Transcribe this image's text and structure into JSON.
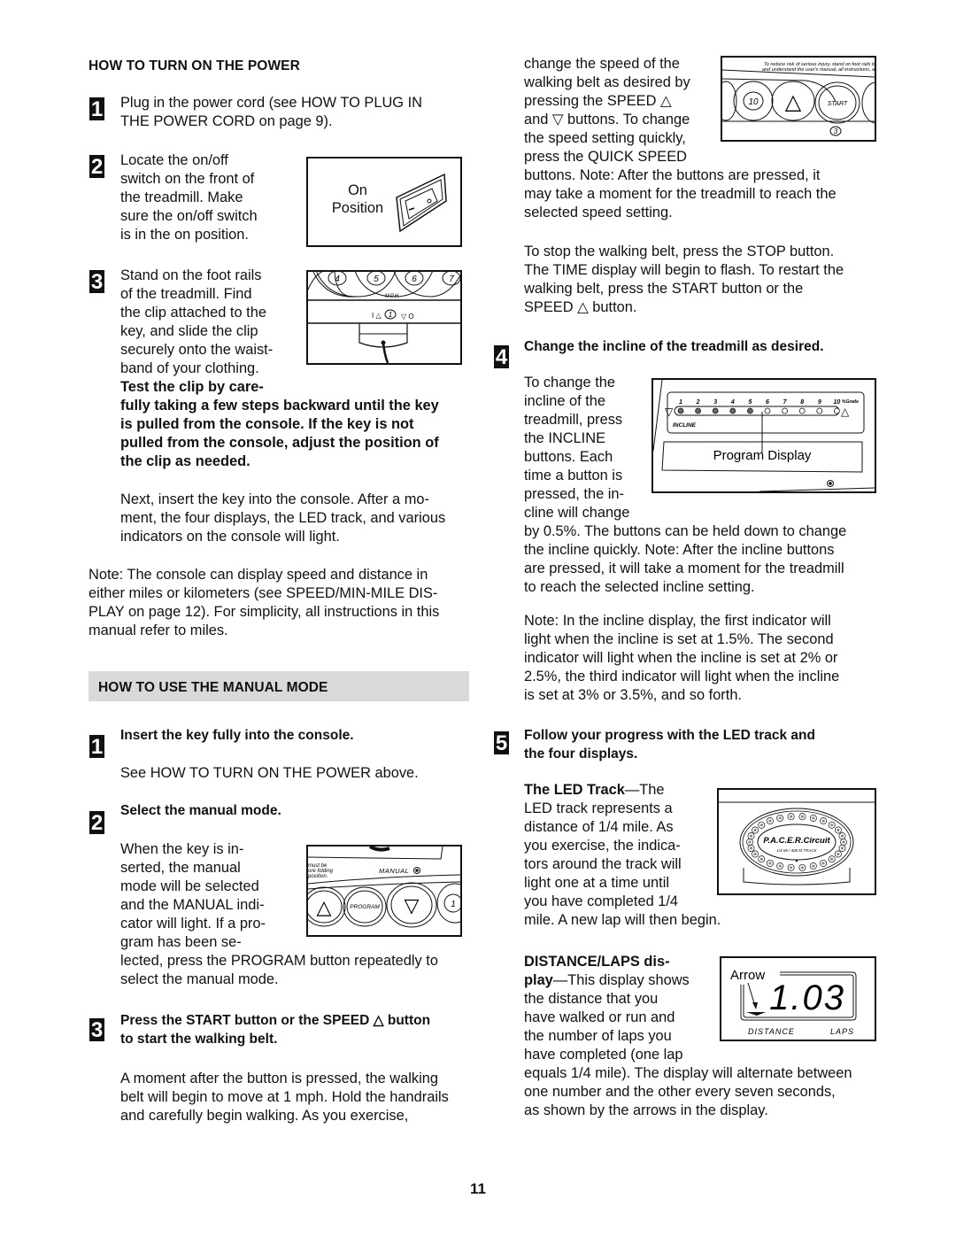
{
  "left": {
    "power_heading": "HOW TO TURN ON THE POWER",
    "power_steps": [
      {
        "num": "1",
        "lines": [
          "Plug in the power cord (see HOW TO PLUG IN",
          "THE POWER CORD on page 9)."
        ]
      },
      {
        "num": "2",
        "lines": [
          "Locate the on/off",
          "switch on the front of",
          "the treadmill. Make",
          "sure the on/off switch",
          "is in the on position."
        ]
      },
      {
        "num": "3",
        "lines": [
          "Stand on the foot rails",
          "of the treadmill. Find",
          "the clip attached to the",
          "key, and slide the clip",
          "securely onto the waist-",
          "band of your clothing."
        ],
        "bold_lines": [
          "Test the clip by care-",
          "fully taking a few steps backward until the key",
          "is pulled from the console. If the key is not",
          "pulled from the console, adjust the position of",
          "the clip as needed."
        ]
      }
    ],
    "switch_figure": {
      "label_line1": "On",
      "label_line2": "Position"
    },
    "key_figure": {
      "speeds": [
        "4",
        "5",
        "6",
        "7"
      ],
      "unit": "MPH",
      "key_label": "1"
    },
    "next_paragraph": [
      "Next, insert the key into the console. After a mo-",
      "ment, the four displays, the LED track, and various",
      "indicators on the console will light."
    ],
    "note_paragraph": [
      "Note: The console can display speed and distance in",
      "either miles or kilometers (see SPEED/MIN-MILE DIS-",
      "PLAY on page 12). For simplicity, all instructions in this",
      "manual refer to miles."
    ],
    "manual_heading": "HOW TO USE THE MANUAL MODE",
    "manual_steps": [
      {
        "num": "1",
        "title": "Insert the key fully into the console.",
        "body": "See HOW TO TURN ON THE POWER above."
      },
      {
        "num": "2",
        "title": "Select the manual mode.",
        "body_lines": [
          "When the key is in-",
          "serted, the manual",
          "mode will be selected",
          "and the MANUAL indi-",
          "cator will light. If a pro-",
          "gram has been se-",
          "lected, press the PROGRAM button repeatedly to",
          "select the manual mode."
        ]
      },
      {
        "num": "3",
        "title_lines": [
          "Press the START button or the SPEED △ button",
          "to start the walking belt."
        ],
        "body_lines": [
          "A moment after the button is pressed, the walking",
          "belt will begin to move at 1 mph. Hold the handrails",
          "and carefully begin walking. As you exercise,"
        ]
      }
    ],
    "manual_figure": {
      "warning_lines": [
        "must be",
        "ore folding",
        "position."
      ],
      "indicator_label": "MANUAL",
      "buttons": [
        "△",
        "PROGRAM",
        "▽",
        "1"
      ]
    }
  },
  "right": {
    "speed_paragraph": [
      "change the speed of the",
      "walking belt as desired by",
      "pressing the SPEED △",
      "and ▽ buttons. To change",
      "the speed setting quickly,",
      "press the QUICK SPEED",
      "buttons. Note: After the buttons are pressed, it",
      "may take a moment for the treadmill to reach the",
      "selected speed setting."
    ],
    "speed_figure": {
      "warning_lines": [
        "To reduce risk of serious injury, stand on foot rails b",
        "and understand the user's manual, all instructions, a"
      ],
      "buttons": [
        "10",
        "△",
        "START"
      ],
      "sub_label": "3"
    },
    "stop_paragraph": [
      "To stop the walking belt, press the STOP button.",
      "The TIME display will begin to flash. To restart the",
      "walking belt, press the START button or the",
      "SPEED △ button."
    ],
    "step4": {
      "num": "4",
      "title": "Change the incline of the treadmill as desired.",
      "body_lines": [
        "To change the",
        "incline of the",
        "treadmill, press",
        "the INCLINE",
        "buttons. Each",
        "time a button is",
        "pressed, the in-",
        "cline will change",
        "by 0.5%. The buttons can be held down to change",
        "the incline quickly. Note: After the incline buttons",
        "are pressed, it will take a moment for the treadmill",
        "to reach the selected incline setting."
      ],
      "note_lines": [
        "Note: In the incline display, the first indicator will",
        "light when the incline is set at 1.5%. The second",
        "indicator will light when the incline is set at 2% or",
        "2.5%, the third indicator will light when the incline",
        "is set at 3% or 3.5%, and so forth."
      ]
    },
    "incline_figure": {
      "ticks": [
        "1",
        "2",
        "3",
        "4",
        "5",
        "6",
        "7",
        "8",
        "9",
        "10"
      ],
      "unit": "%Grade",
      "label": "INCLINE",
      "callout": "Program Display",
      "lit_count": 5
    },
    "step5": {
      "num": "5",
      "title_lines": [
        "Follow your progress with the LED track and",
        "the four displays."
      ],
      "led_title": "The LED Track",
      "led_lines": [
        "—The",
        "LED track represents a",
        "distance of 1/4 mile. As",
        "you exercise, the indica-",
        "tors around the track will",
        "light one at a time until",
        "you have completed 1/4",
        "mile. A new lap will then begin."
      ],
      "dist_title_1": "DISTANCE/LAPS dis-",
      "dist_title_2": "play",
      "dist_lines": [
        "—This display shows",
        "the distance that you",
        "have walked or run and",
        "the number of laps you",
        "have completed (one lap",
        "equals 1/4 mile). The display will alternate between",
        "one number and the other every seven seconds,",
        "as shown by the arrows in the display."
      ]
    },
    "track_figure": {
      "brand": "P.A.C.E.R.Circuit",
      "subtitle": "1/4 MI  /  400 M  TRACK"
    },
    "distance_figure": {
      "arrow_label": "Arrow",
      "value": "1.03",
      "label_left": "DISTANCE",
      "label_right": "LAPS"
    }
  },
  "page_number": "11"
}
